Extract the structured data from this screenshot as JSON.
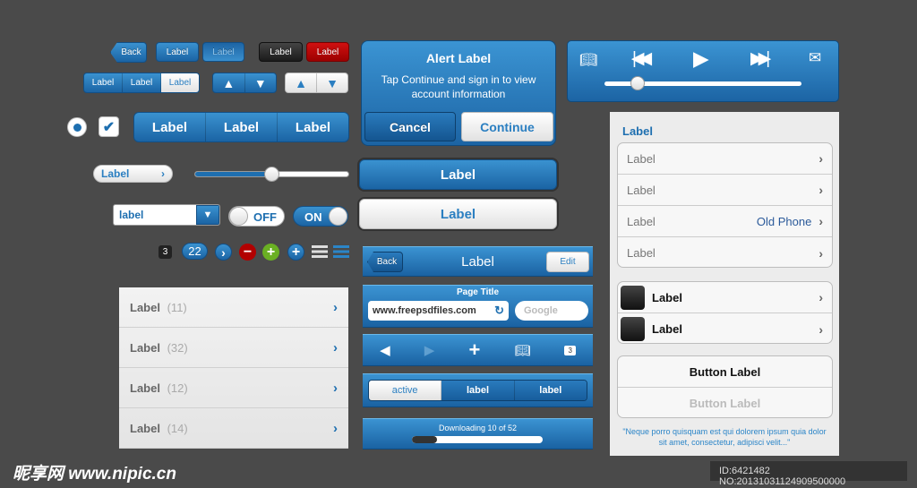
{
  "controls": {
    "back": "Back",
    "btn_blue": "Label",
    "btn_blue_pressed": "Label",
    "btn_dark": "Label",
    "btn_red": "Label",
    "seg_small": [
      "Label",
      "Label",
      "Label"
    ],
    "seg_big": [
      "Label",
      "Label",
      "Label"
    ],
    "pill": "Label",
    "slider_value": 0.5,
    "dropdown_value": "label",
    "toggle_off": "OFF",
    "toggle_on": "ON",
    "badge_dark": "3",
    "badge_blue": "22"
  },
  "list": [
    {
      "label": "Label",
      "count": "(11)"
    },
    {
      "label": "Label",
      "count": "(32)"
    },
    {
      "label": "Label",
      "count": "(12)"
    },
    {
      "label": "Label",
      "count": "(14)"
    }
  ],
  "alert": {
    "title": "Alert Label",
    "message": "Tap Continue and sign in to view account information",
    "cancel": "Cancel",
    "continue": "Continue"
  },
  "big_blue_button": "Label",
  "big_white_button": "Label",
  "navbar": {
    "back": "Back",
    "title": "Label",
    "edit": "Edit"
  },
  "browser": {
    "page_title": "Page Title",
    "url": "www.freepsdfiles.com",
    "search_placeholder": "Google",
    "tabs_count": "3"
  },
  "segment_bar": [
    "active",
    "label",
    "label"
  ],
  "download": {
    "text": "Downloading 10 of 52",
    "progress": 0.19
  },
  "media": {
    "progress": 0.17
  },
  "table": {
    "header": "Label",
    "group1": [
      {
        "label": "Label",
        "detail": ""
      },
      {
        "label": "Label",
        "detail": ""
      },
      {
        "label": "Label",
        "detail": "Old Phone"
      },
      {
        "label": "Label",
        "detail": ""
      }
    ],
    "group2": [
      {
        "label": "Label"
      },
      {
        "label": "Label"
      }
    ],
    "button_primary": "Button Label",
    "button_disabled": "Button Label",
    "footer": "\"Neque porro quisquam est qui dolorem ipsum quia dolor sit amet, consectetur, adipisci velit...\""
  },
  "watermark": {
    "logo": "昵享网 www.nipic.cn",
    "id": "ID:6421482 NO:20131031124909500000"
  },
  "colors": {
    "accent": "#1e6fb0",
    "background": "#4a4a4a",
    "red": "#b20000",
    "green": "#6ab023"
  }
}
